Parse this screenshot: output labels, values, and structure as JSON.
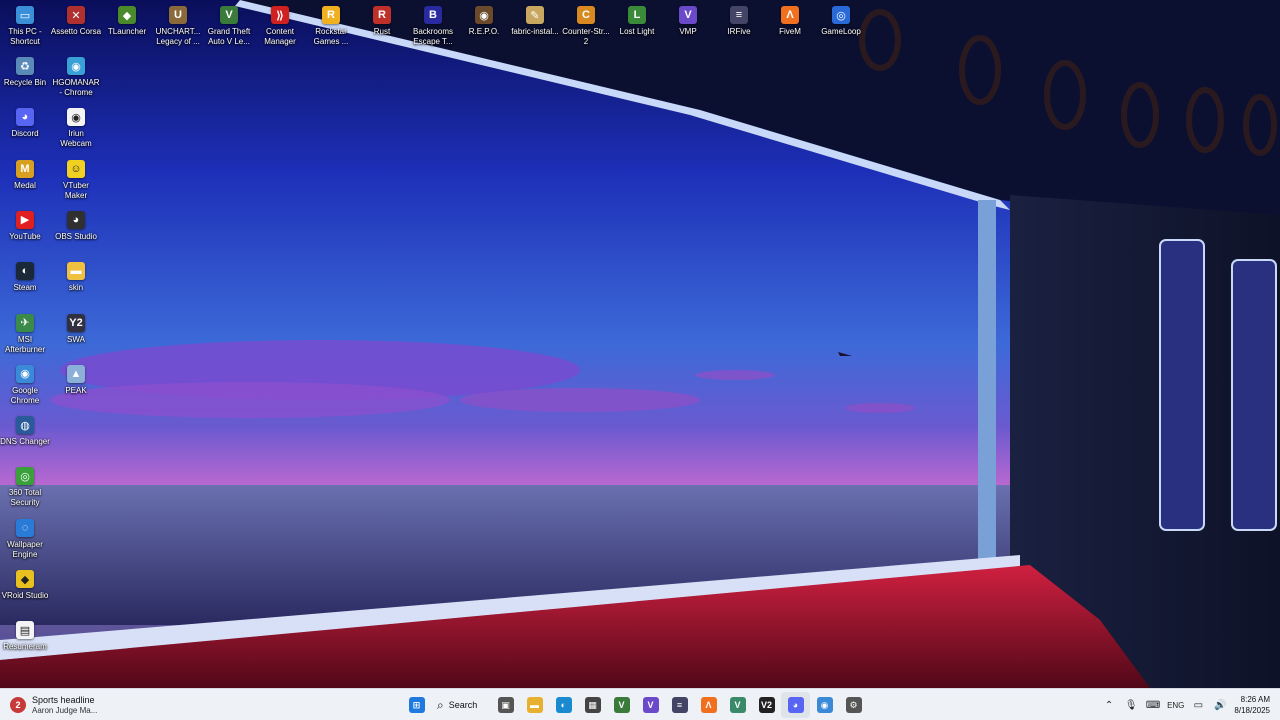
{
  "desktop": {
    "top_row": [
      {
        "id": "this-pc",
        "label": "This PC -\nShortcut",
        "icon": "computer-icon",
        "color": "#3b8fd8",
        "glyph": "▭"
      },
      {
        "id": "assetto-corsa",
        "label": "Assetto Corsa",
        "icon": "assetto-corsa-icon",
        "color": "#b03030",
        "glyph": "✕"
      },
      {
        "id": "tlauncher",
        "label": "TLauncher",
        "icon": "tlauncher-icon",
        "color": "#4a8a2a",
        "glyph": "◆"
      },
      {
        "id": "uncharted",
        "label": "UNCHART...\nLegacy of ...",
        "icon": "uncharted-icon",
        "color": "#8a6a3a",
        "glyph": "U"
      },
      {
        "id": "gta5",
        "label": "Grand Theft\nAuto V Le...",
        "icon": "gta5-icon",
        "color": "#3a7a3a",
        "glyph": "V"
      },
      {
        "id": "content-manager",
        "label": "Content\nManager",
        "icon": "content-manager-icon",
        "color": "#d02020",
        "glyph": "⟫"
      },
      {
        "id": "rockstar",
        "label": "Rockstar\nGames ...",
        "icon": "rockstar-icon",
        "color": "#f0b020",
        "glyph": "R"
      },
      {
        "id": "rust",
        "label": "Rust",
        "icon": "rust-icon",
        "color": "#c0302a",
        "glyph": "R"
      },
      {
        "id": "backrooms",
        "label": "Backrooms\nEscape T...",
        "icon": "backrooms-icon",
        "color": "#2a2aa0",
        "glyph": "B"
      },
      {
        "id": "repo",
        "label": "R.E.P.O.",
        "icon": "repo-icon",
        "color": "#6a4a2a",
        "glyph": "◉"
      },
      {
        "id": "fabric",
        "label": "fabric-instal...",
        "icon": "fabric-installer-icon",
        "color": "#c8a860",
        "glyph": "✎"
      },
      {
        "id": "cs2",
        "label": "Counter-Str...\n2",
        "icon": "counter-strike-icon",
        "color": "#d88a20",
        "glyph": "C"
      },
      {
        "id": "lost-light",
        "label": "Lost Light",
        "icon": "lost-light-icon",
        "color": "#3a8a3a",
        "glyph": "L"
      },
      {
        "id": "vmp",
        "label": "VMP",
        "icon": "vmp-icon",
        "color": "#6a4ac8",
        "glyph": "V"
      },
      {
        "id": "irfive",
        "label": "IRFive",
        "icon": "irfive-icon",
        "color": "#444466",
        "glyph": "≡"
      },
      {
        "id": "fivem",
        "label": "FiveM",
        "icon": "fivem-icon",
        "color": "#f07020",
        "glyph": "Λ"
      },
      {
        "id": "gameloop",
        "label": "GameLoop",
        "icon": "gameloop-icon",
        "color": "#2a6ad8",
        "glyph": "◎"
      }
    ],
    "col_1": [
      {
        "id": "recycle-bin",
        "label": "Recycle Bin",
        "icon": "recycle-bin-icon",
        "color": "#5a8ab8",
        "glyph": "♻"
      },
      {
        "id": "discord",
        "label": "Discord",
        "icon": "discord-icon",
        "color": "#5865f2",
        "glyph": "◕"
      },
      {
        "id": "medal",
        "label": "Medal",
        "icon": "medal-icon",
        "color": "#d8a020",
        "glyph": "M"
      },
      {
        "id": "youtube",
        "label": "YouTube",
        "icon": "youtube-icon",
        "color": "#e02020",
        "glyph": "▶"
      },
      {
        "id": "steam",
        "label": "Steam",
        "icon": "steam-icon",
        "color": "#1b2838",
        "glyph": "◐"
      },
      {
        "id": "msi-afterburner",
        "label": "MSI\nAfterburner",
        "icon": "msi-afterburner-icon",
        "color": "#3a8a4a",
        "glyph": "✈"
      },
      {
        "id": "google-chrome",
        "label": "Google\nChrome",
        "icon": "chrome-icon",
        "color": "#3a8ad8",
        "glyph": "◉"
      },
      {
        "id": "dns-changer",
        "label": "DNS Changer",
        "icon": "dns-changer-icon",
        "color": "#2a5a9a",
        "glyph": "◍"
      },
      {
        "id": "360-total-security",
        "label": "360 Total\nSecurity",
        "icon": "360-security-icon",
        "color": "#3aa03a",
        "glyph": "◎"
      },
      {
        "id": "wallpaper-engine",
        "label": "Wallpaper\nEngine",
        "icon": "wallpaper-engine-icon",
        "color": "#2a7ad8",
        "glyph": "◌"
      },
      {
        "id": "vroid-studio",
        "label": "VRoid Studio",
        "icon": "vroid-studio-icon",
        "color": "#e8c020",
        "glyph": "◆"
      },
      {
        "id": "document",
        "label": "Resumeram",
        "icon": "document-icon",
        "color": "#f4f4f4",
        "glyph": "▤"
      }
    ],
    "col_2": [
      {
        "id": "hgomanar",
        "label": "HGOMANAR\n- Chrome",
        "icon": "chrome-profile-icon",
        "color": "#3aa0d8",
        "glyph": "◉"
      },
      {
        "id": "iriun-webcam",
        "label": "Iriun\nWebcam",
        "icon": "iriun-webcam-icon",
        "color": "#f4f4f4",
        "glyph": "◉"
      },
      {
        "id": "vtuber-maker",
        "label": "VTuber\nMaker",
        "icon": "vtuber-maker-icon",
        "color": "#f0d020",
        "glyph": "☺"
      },
      {
        "id": "obs-studio",
        "label": "OBS Studio",
        "icon": "obs-studio-icon",
        "color": "#303030",
        "glyph": "◕"
      },
      {
        "id": "skin",
        "label": "skin",
        "icon": "folder-icon",
        "color": "#f0c040",
        "glyph": "▬"
      },
      {
        "id": "swa",
        "label": "SWA",
        "icon": "swa-icon",
        "color": "#303040",
        "glyph": "Y2"
      },
      {
        "id": "peak",
        "label": "PEAK",
        "icon": "peak-icon",
        "color": "#8ab0d8",
        "glyph": "▲"
      }
    ]
  },
  "taskbar": {
    "widget": {
      "title": "Sports headline",
      "subtitle": "Aaron Judge Ma...",
      "badge": "2"
    },
    "search_label": "Search",
    "apps": [
      {
        "id": "start",
        "icon": "windows-start-icon",
        "color": "#1f7ae0",
        "glyph": "⊞"
      },
      {
        "id": "search",
        "icon": "search-icon"
      },
      {
        "id": "task-view",
        "icon": "task-view-icon",
        "color": "#555",
        "glyph": "▣"
      },
      {
        "id": "file-explorer",
        "icon": "file-explorer-icon",
        "color": "#e8b030",
        "glyph": "▬"
      },
      {
        "id": "edge",
        "icon": "edge-icon",
        "color": "#1a8ad0",
        "glyph": "◐"
      },
      {
        "id": "store",
        "icon": "microsoft-store-icon",
        "color": "#444",
        "glyph": "▦"
      },
      {
        "id": "gta-launcher",
        "icon": "gta-icon",
        "color": "#3a7a3a",
        "glyph": "V"
      },
      {
        "id": "vmp",
        "icon": "vmp-icon",
        "color": "#6a4ac8",
        "glyph": "V"
      },
      {
        "id": "irfive",
        "icon": "irfive-icon",
        "color": "#444466",
        "glyph": "≡"
      },
      {
        "id": "fivem",
        "icon": "fivem-icon",
        "color": "#f07020",
        "glyph": "Λ"
      },
      {
        "id": "vmp-green",
        "icon": "v-app-icon",
        "color": "#3a8a6a",
        "glyph": "V"
      },
      {
        "id": "v2",
        "icon": "v2-icon",
        "color": "#222",
        "glyph": "V2"
      },
      {
        "id": "discord",
        "icon": "discord-icon",
        "color": "#5865f2",
        "glyph": "◕",
        "active": true
      },
      {
        "id": "chrome",
        "icon": "chrome-icon",
        "color": "#3a8ad8",
        "glyph": "◉"
      },
      {
        "id": "settings",
        "icon": "settings-icon",
        "color": "#555",
        "glyph": "⚙"
      }
    ],
    "tray": {
      "language": "ENG",
      "time": "8:26 AM",
      "date": "8/18/2025"
    }
  }
}
